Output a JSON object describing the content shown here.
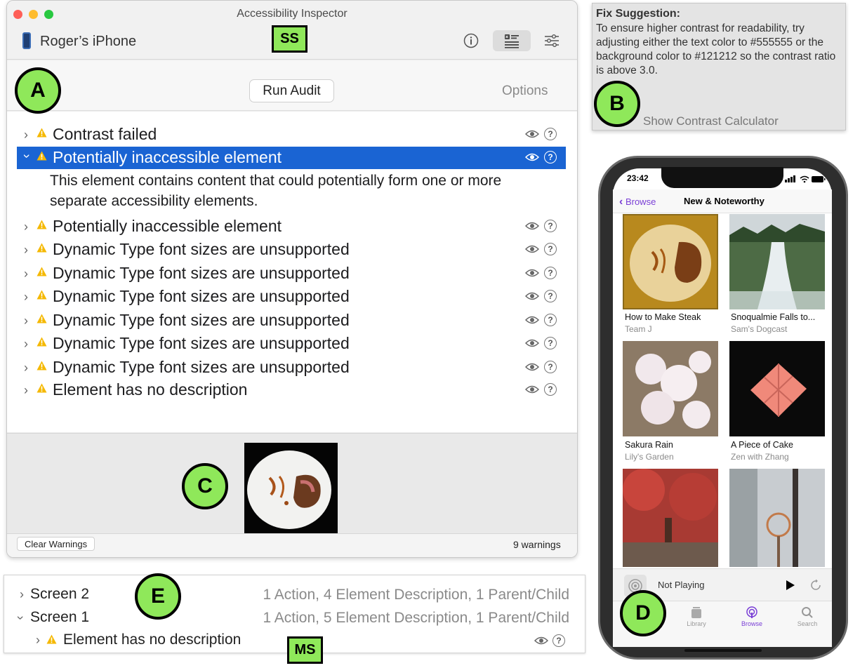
{
  "window": {
    "title": "Accessibility Inspector",
    "device_name": "Roger’s iPhone",
    "info_icon": "info-icon",
    "audit_icon": "audit-icon",
    "settings_icon": "sliders-icon"
  },
  "audit": {
    "run_label": "Run Audit",
    "options_label": "Options"
  },
  "issues": [
    {
      "label": "Contrast failed",
      "expanded": false
    },
    {
      "label": "Potentially inaccessible element",
      "expanded": true
    },
    {
      "label": "Potentially inaccessible element",
      "expanded": false
    },
    {
      "label": "Dynamic Type font sizes are unsupported",
      "expanded": false
    },
    {
      "label": "Dynamic Type font sizes are unsupported",
      "expanded": false
    },
    {
      "label": "Dynamic Type font sizes are unsupported",
      "expanded": false
    },
    {
      "label": "Dynamic Type font sizes are unsupported",
      "expanded": false
    },
    {
      "label": "Dynamic Type font sizes are unsupported",
      "expanded": false
    },
    {
      "label": "Dynamic Type font sizes are unsupported",
      "expanded": false
    },
    {
      "label": "Element has no description",
      "expanded": false
    }
  ],
  "expanded_description": "This element contains content that could potentially form one or more separate accessibility elements.",
  "footer": {
    "clear_label": "Clear Warnings",
    "warning_count": "9 warnings"
  },
  "fix": {
    "title": "Fix Suggestion:",
    "body": "To ensure higher contrast for readability, try adjusting either the text color to #555555 or the background color to #121212 so the contrast ratio is above 3.0.",
    "link": "Show Contrast Calculator"
  },
  "multiscreen": {
    "screen2_name": "Screen 2",
    "screen2_summary": "1 Action, 4 Element Description, 1 Parent/Child",
    "screen1_name": "Screen 1",
    "screen1_summary": "1 Action, 5 Element Description, 1 Parent/Child",
    "child_label": "Element has no description"
  },
  "phone": {
    "time": "23:42",
    "back_label": "Browse",
    "nav_title": "New & Noteworthy",
    "tiles": [
      {
        "title": "How to Make Steak",
        "subtitle": "Team J"
      },
      {
        "title": "Snoqualmie Falls to...",
        "subtitle": "Sam's Dogcast"
      },
      {
        "title": "Sakura Rain",
        "subtitle": "Lily's Garden"
      },
      {
        "title": "A Piece of Cake",
        "subtitle": "Zen with Zhang"
      }
    ],
    "player_label": "Not Playing",
    "tabs": [
      {
        "label": "Library"
      },
      {
        "label": "Browse"
      },
      {
        "label": "Search"
      }
    ],
    "accent_color": "#7a3fd6"
  },
  "callouts": {
    "a": "A",
    "b": "B",
    "c": "C",
    "d": "D",
    "e": "E",
    "ss": "SS",
    "ms": "MS"
  },
  "colors": {
    "selection": "#1a64d3",
    "callout": "#8fe85a",
    "warning": "#f5b800"
  }
}
